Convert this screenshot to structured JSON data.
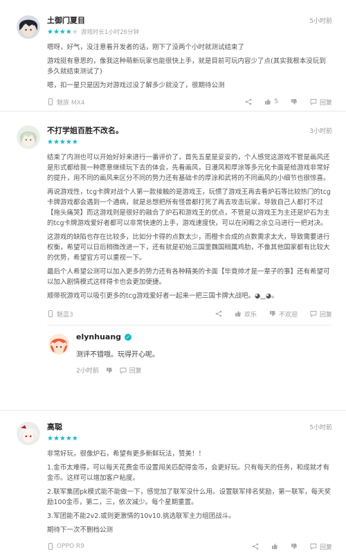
{
  "reviews": [
    {
      "user": "土御门夏目",
      "time": "5小时前",
      "playtime": "游戏时长1小时26分钟",
      "paragraphs": [
        "嗯呀，好气，没注意看开发者的话，刚下了没两个小时就测试结束了",
        "游戏挺有意思的，像我这种萌新玩家也能很快上手，就是目前可玩内容少了点(其实我根本没玩到多久就结束测试了)",
        "嗯，扣一星只是因为对游戏过没了解多少就没了，很期待公测"
      ],
      "device": "魅族 MX4",
      "likes": "5",
      "reply_label": "回复"
    },
    {
      "user": "不打学姐百胜不改名。",
      "time": "3小时前",
      "paragraphs": [
        "结束了内测也可以开始好好来进行一番评价了，首先五星是妥妥的，个人感觉这游戏不管是画风还是形式都给我一种愿意继续玩下去的体会，先看画风，日漫风和厚涂等多元化卡面是给游戏非常好的提升，用不同的画风来区分不同的势力还有基础卡的厚涂和武将的不同画风的小细节也很惊喜。",
        "再说游戏性，tcg卡牌对战个人第一款接触的是游戏王，玩惯了游戏王再去看炉石等比较热门的tcg卡牌游戏都会遇到一个通病，就是总想把所有怪兽都打死了再去攻击玩家，导致自己人都打不过【拖头痛哭】而这游戏则是很好的融合了炉石和游戏王的优点，不管是以游戏王为主还是炉石为主的tcg卡牌游戏爱好者都可以非常快速的上手，游戏速度快，可以在闲暇之余立马进行一把对决。",
        "这游戏的缺陷也存在比较多，比如分卡得的点数太少，而橙卡合成的点数需求太大，导致需要进行权衡，希望可以日后稍微改进一下，还有就是初始三国里魏国稍属鸡肋，不像其他国家都有比较大的优势，希望官方可以重视一下。",
        "最后个人希望公测可以加入更多的势力还有各种精美的卡面【毕竟帅才是一辈子的事】还有希望可以加入剧情模式这样得卡也会更加便捷。",
        "顺带祝游戏可以吸引更多的tcg游戏爱好者一起来一把三国卡牌大战吧。◕‿◕。"
      ],
      "device": "魅蓝3",
      "likes": "",
      "dislike_label": "",
      "reply_label": "回复",
      "follow_label": "欢乐",
      "unwelcome_label": "不欢迎",
      "dev_reply": {
        "user": "elynhuang",
        "text": "测评不错哦。玩得开心呢。",
        "time": "2小时前",
        "reply_label": "回复"
      }
    },
    {
      "user": "高聪",
      "time": "5小时前",
      "paragraphs": [
        "非常好玩，很像炉石，希望有更多新鲜玩法，赞美！！",
        "1.金币太难得，可以每天花费金币设置闯关匹配得金币，会更好玩。只有每天的任务，和成就才有金币。这样可以增加客户粘度。",
        "2.联军集团pk模式能不能做一下，感觉加了联军没什么用。设置联军排名奖励，第一联军，每天奖励100金币，第二，三，依次减少。每个星期重置。",
        "3.军团能不能2v2.或则更激情的10v10.挑选联军主力组团战斗。",
        "期待下一次不删档公测"
      ],
      "device": "OPPO R9",
      "likes": "",
      "reply_label": "回复"
    }
  ],
  "labels": {
    "comment": "欢乐",
    "oppose": "不欢迎",
    "reply": "回复"
  },
  "colors": {
    "accent": "#14b9c8",
    "text": "#555555",
    "muted": "#999999"
  }
}
